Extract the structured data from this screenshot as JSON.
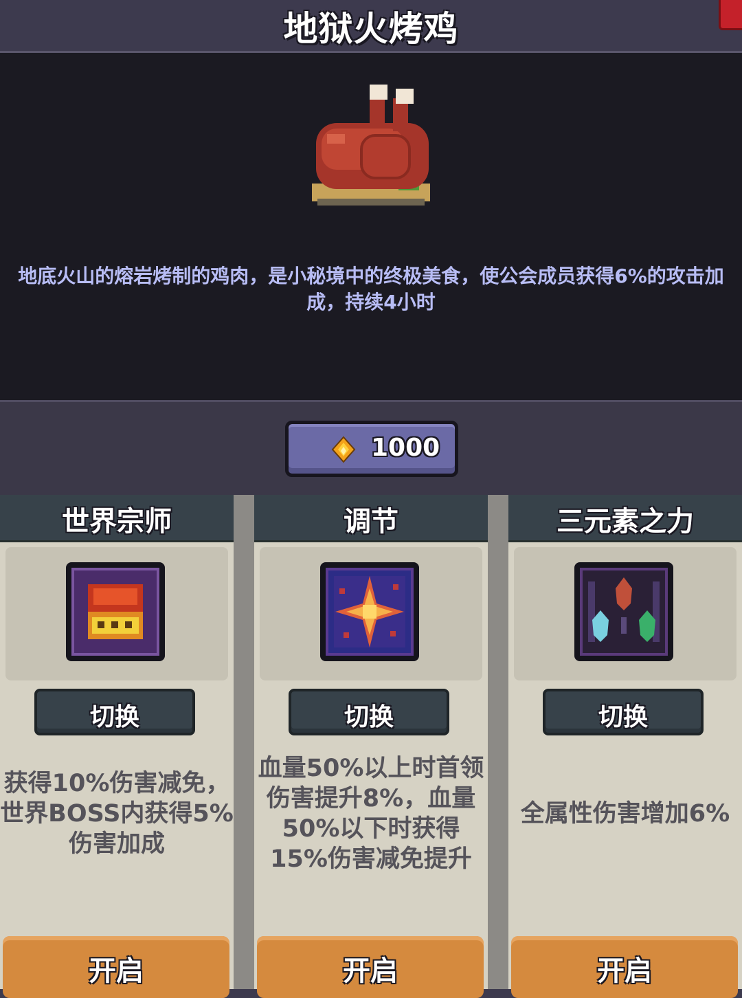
{
  "item": {
    "title": "地狱火烤鸡",
    "icon": "roast-chicken-icon",
    "description": "地底火山的熔岩烤制的鸡肉，是小秘境中的终极美食，使公会成员获得6%的攻击加成，持续4小时"
  },
  "cost": {
    "icon": "flame-crystal-icon",
    "value": "1000"
  },
  "skills": [
    {
      "title": "世界宗师",
      "icon": "crown-icon",
      "switch_label": "切换",
      "description": "获得10%伤害减免，世界BOSS内获得5%伤害加成",
      "enable_label": "开启"
    },
    {
      "title": "调节",
      "icon": "burst-star-icon",
      "switch_label": "切换",
      "description": "血量50%以上时首领伤害提升8%，血量50%以下时获得15%伤害减免提升",
      "enable_label": "开启"
    },
    {
      "title": "三元素之力",
      "icon": "three-elements-icon",
      "switch_label": "切换",
      "description": "全属性伤害增加6%",
      "enable_label": "开启"
    }
  ]
}
